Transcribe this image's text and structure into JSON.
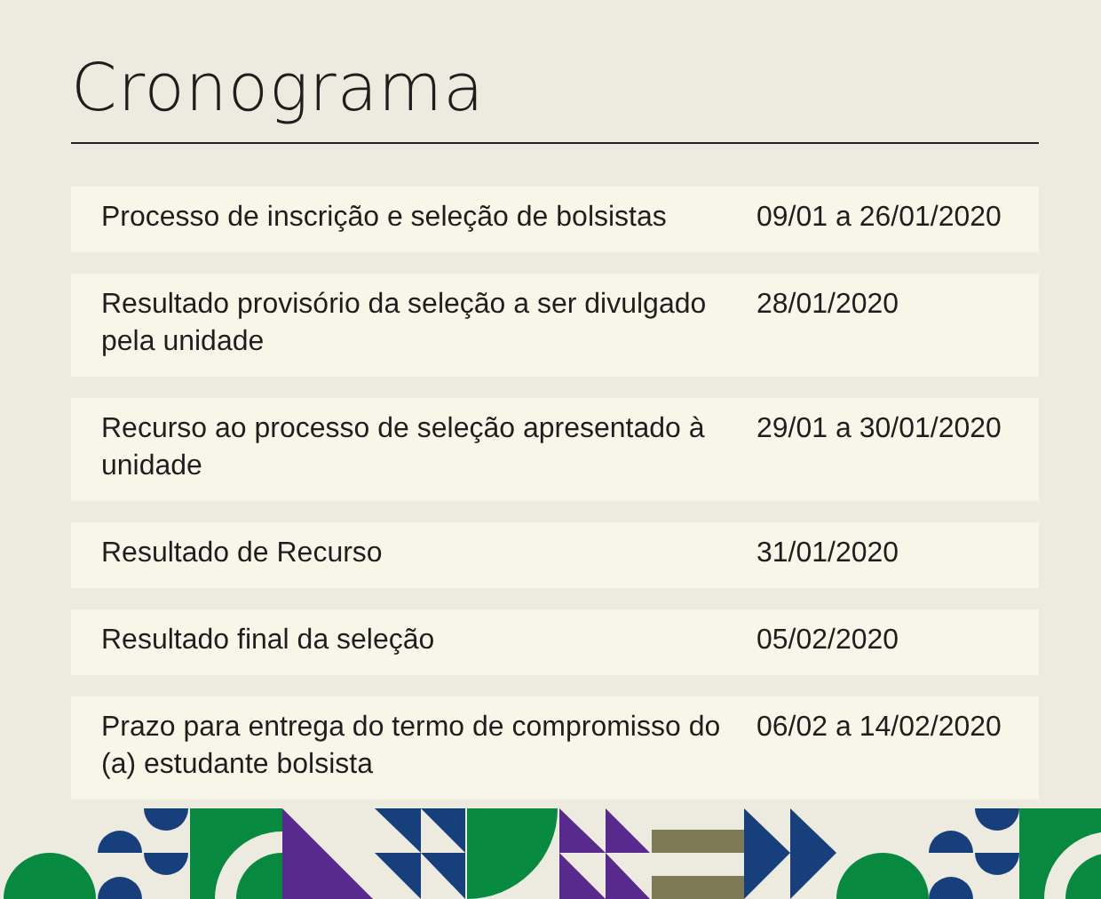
{
  "title": "Cronograma",
  "rows": [
    {
      "event": "Processo de inscrição e seleção de bolsistas",
      "date": "09/01 a 26/01/2020"
    },
    {
      "event": "Resultado provisório da seleção a ser divulgado pela unidade",
      "date": "28/01/2020"
    },
    {
      "event": "Recurso ao processo de seleção apresentado à unidade",
      "date": "29/01 a 30/01/2020"
    },
    {
      "event": "Resultado de Recurso",
      "date": "31/01/2020"
    },
    {
      "event": "Resultado final da seleção",
      "date": "05/02/2020"
    },
    {
      "event": "Prazo para entrega do termo de compromisso do (a) estudante bolsista",
      "date": "06/02 a 14/02/2020"
    }
  ]
}
